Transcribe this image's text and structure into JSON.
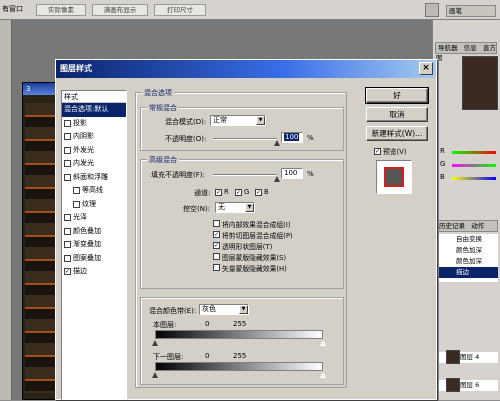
{
  "ps_bg": {
    "options_bar": {
      "left_label": "有窗口",
      "buttons": [
        "实际像素",
        "满画布显示",
        "打印尺寸"
      ]
    },
    "document": {
      "title": "3"
    },
    "right_panel": {
      "tabs": [
        "导航器",
        "信息",
        "直方图"
      ],
      "tool_preset": "画笔",
      "color_labels": [
        "R",
        "G",
        "B"
      ],
      "history_tabs": [
        "历史记录",
        "动作"
      ],
      "history_items": [
        "自由变换",
        "颜色加深",
        "颜色加深",
        "描边"
      ],
      "layers": [
        "图层 4",
        "图层 6"
      ]
    }
  },
  "dialog": {
    "title": "图层样式",
    "close_glyph": "×",
    "styles_header": "样式",
    "style_items": [
      {
        "label": "混合选项:默认",
        "checkbox": false,
        "checked": false,
        "selected": true,
        "indent": 0
      },
      {
        "label": "投影",
        "checkbox": true,
        "checked": false,
        "selected": false,
        "indent": 0
      },
      {
        "label": "内阴影",
        "checkbox": true,
        "checked": false,
        "selected": false,
        "indent": 0
      },
      {
        "label": "外发光",
        "checkbox": true,
        "checked": false,
        "selected": false,
        "indent": 0
      },
      {
        "label": "内发光",
        "checkbox": true,
        "checked": false,
        "selected": false,
        "indent": 0
      },
      {
        "label": "斜面和浮雕",
        "checkbox": true,
        "checked": false,
        "selected": false,
        "indent": 0
      },
      {
        "label": "等高线",
        "checkbox": true,
        "checked": false,
        "selected": false,
        "indent": 1
      },
      {
        "label": "纹理",
        "checkbox": true,
        "checked": false,
        "selected": false,
        "indent": 1
      },
      {
        "label": "光泽",
        "checkbox": true,
        "checked": false,
        "selected": false,
        "indent": 0
      },
      {
        "label": "颜色叠加",
        "checkbox": true,
        "checked": false,
        "selected": false,
        "indent": 0
      },
      {
        "label": "渐变叠加",
        "checkbox": true,
        "checked": false,
        "selected": false,
        "indent": 0
      },
      {
        "label": "图案叠加",
        "checkbox": true,
        "checked": false,
        "selected": false,
        "indent": 0
      },
      {
        "label": "描边",
        "checkbox": true,
        "checked": true,
        "selected": false,
        "indent": 0
      }
    ],
    "blending": {
      "group_title": "混合选项",
      "general_title": "常规混合",
      "blend_mode_label": "混合模式(D):",
      "blend_mode_value": "正常",
      "opacity_label": "不透明度(O):",
      "opacity_value": "100",
      "percent": "%",
      "advanced_title": "高级混合",
      "fill_opacity_label": "填充不透明度(F):",
      "fill_opacity_value": "100",
      "channels_label": "通道:",
      "channels": [
        "R",
        "G",
        "B"
      ],
      "knockout_label": "挖空(N):",
      "knockout_value": "无",
      "options": [
        {
          "label": "将内部效果混合成组(I)",
          "checked": false
        },
        {
          "label": "将剪切图层混合成组(P)",
          "checked": true
        },
        {
          "label": "透明形状图层(T)",
          "checked": true
        },
        {
          "label": "图层蒙版隐藏效果(S)",
          "checked": false
        },
        {
          "label": "矢量蒙版隐藏效果(H)",
          "checked": false
        }
      ],
      "blend_if_label": "混合颜色带(E):",
      "blend_if_value": "灰色",
      "this_layer_label": "本图层:",
      "this_layer_min": "0",
      "this_layer_max": "255",
      "under_layer_label": "下一图层:",
      "under_layer_min": "0",
      "under_layer_max": "255"
    },
    "buttons": {
      "ok": "好",
      "cancel": "取消",
      "new_style": "新建样式(W)...",
      "preview_label": "预览(V)",
      "preview_checked": true
    },
    "colors": {
      "title_start": "#0a246a",
      "selection": "#0a246a",
      "preview_border": "#d62020",
      "preview_fill": "#555555"
    }
  }
}
